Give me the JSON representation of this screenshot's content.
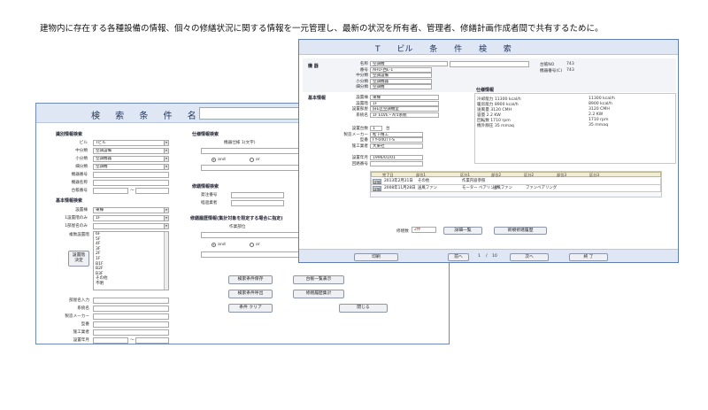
{
  "headline": "建物内に存在する各種設備の情報、個々の修繕状況に関する情報を一元管理し、最新の状況を所有者、管理者、修繕計画作成者間で共有するために。",
  "search_window": {
    "title": "検 索 条 件 名",
    "title_value": "",
    "sections": {
      "classification": "識別情報検索",
      "basic": "基本情報検索",
      "spec": "仕様情報検索",
      "repair": "修繕情報検索",
      "history": "修繕履歴情報(集計対象を限定する場合に指定)"
    },
    "classification_fields": [
      {
        "label": "ビル",
        "value": "Tビル",
        "dropdown": true
      },
      {
        "label": "中分類",
        "value": "空調設備",
        "dropdown": true
      },
      {
        "label": "小分類",
        "value": "空調機器",
        "dropdown": true
      },
      {
        "label": "細分類",
        "value": "空調機",
        "dropdown": true
      },
      {
        "label": "機器番号",
        "value": "",
        "dropdown": false
      },
      {
        "label": "機器名称",
        "value": "",
        "dropdown": false
      },
      {
        "label": "台帳番号",
        "value": "",
        "dropdown": false
      }
    ],
    "tilde": "〜",
    "basic_fields": [
      {
        "label": "設置棟",
        "value": "東棟",
        "dropdown": true
      },
      {
        "label": "1設置階のみ",
        "value": "1F",
        "dropdown": true
      },
      {
        "label": "1部屋名のみ",
        "value": "",
        "dropdown": true
      }
    ],
    "multi_floor_label": "複数設置階",
    "floor_options": [
      "6F",
      "5F",
      "4F",
      "3F",
      "2F",
      "1F",
      "B1F",
      "B2F",
      "B3F",
      "その他",
      "不明"
    ],
    "floor_confirm_button": "設置階\n決定",
    "lower_fields": [
      {
        "label": "部屋名入力",
        "value": ""
      },
      {
        "label": "系統名",
        "value": ""
      },
      {
        "label": "製造メーカー",
        "value": ""
      },
      {
        "label": "型番",
        "value": ""
      },
      {
        "label": "施工業者",
        "value": ""
      },
      {
        "label": "設置年月",
        "value": ""
      }
    ],
    "spec_label": "機器仕様 1(文字)",
    "radio_and": "and",
    "radio_or": "or",
    "repair_fields": [
      {
        "label": "発注番号",
        "value": ""
      },
      {
        "label": "経過業者",
        "value": ""
      }
    ],
    "history_label": "作業部位",
    "buttons": {
      "save": "検索条件保存",
      "recall": "検索条件呼出",
      "clear": "条件 クリア",
      "list": "台帳一覧表示",
      "aggregate": "修繕履歴集計",
      "close": "閉じる"
    }
  },
  "detail_window": {
    "title": "T ビル 条 件 検 索",
    "equipment": {
      "section": "機 器",
      "fields": [
        {
          "label": "名称",
          "value": "空調機"
        },
        {
          "label": "番号",
          "value": "AHU-西E-1"
        },
        {
          "label": "中分類",
          "value": "空調設備"
        },
        {
          "label": "小分類",
          "value": "空調機器"
        },
        {
          "label": "細分類",
          "value": "空調機"
        }
      ],
      "ledger_no_label": "台帳NO",
      "ledger_no": "743",
      "equip_no_label": "機器番号(C)",
      "equip_no": "743"
    },
    "basic": {
      "section": "基本情報",
      "fields": [
        {
          "label": "設置棟",
          "value": "東棟"
        },
        {
          "label": "設置階",
          "value": "1F"
        },
        {
          "label": "設置部屋",
          "value": "旧E区空調機室"
        },
        {
          "label": "系統名",
          "value": "1F ELVE・A/1系統"
        }
      ]
    },
    "install": {
      "fields": [
        {
          "label": "設置台数",
          "value": "1",
          "unit": "台"
        },
        {
          "label": "製造メーカー",
          "value": "松下精工",
          "unit": ""
        },
        {
          "label": "型番",
          "value": "FY-04UTT-S",
          "unit": ""
        },
        {
          "label": "施工業者",
          "value": "大東社",
          "unit": ""
        }
      ]
    },
    "dates": {
      "fields": [
        {
          "label": "設置年月",
          "value": "1996/01/01"
        },
        {
          "label": "回路番号",
          "value": ""
        }
      ]
    },
    "spec": {
      "section": "仕様情報",
      "rows": [
        {
          "text": "冷却能力 11300 kcal/h",
          "value": "11300 kcal/h"
        },
        {
          "text": "暖房能力 8900 kcal/h",
          "value": "8900 kcal/h"
        },
        {
          "text": "送風量 3120 CMH",
          "value": "3120 CMH"
        },
        {
          "text": "容量 2.2 KW",
          "value": "2.2 KW"
        },
        {
          "text": "回転数 1710 rpm",
          "value": "1710 rpm"
        },
        {
          "text": "機外静圧 35 mmaq",
          "value": "35 mmaq"
        }
      ]
    },
    "history_table": {
      "headers": [
        "完了日",
        "部位1",
        "区分1",
        "部位2",
        "区分2",
        "部位3",
        "区分3"
      ],
      "rows": [
        {
          "button": "詳細",
          "cells": [
            "2013年2月21日",
            "その他",
            "作業内容参照",
            "",
            "",
            "",
            ""
          ]
        },
        {
          "button": "詳細",
          "cells": [
            "2008年11月28日",
            "送風ファン",
            "モーター ベアリング",
            "送風ファン",
            "ファンベアリング",
            "",
            ""
          ]
        }
      ]
    },
    "repair_count_label": "修繕数",
    "repair_count": "2件",
    "btn_detail_list": "詳細一覧",
    "btn_new_history": "新規修繕履歴",
    "footer": {
      "print": "印刷",
      "prev": "前へ",
      "page": "1",
      "sep": "/",
      "total": "10",
      "next": "次へ",
      "end": "終 了"
    }
  }
}
